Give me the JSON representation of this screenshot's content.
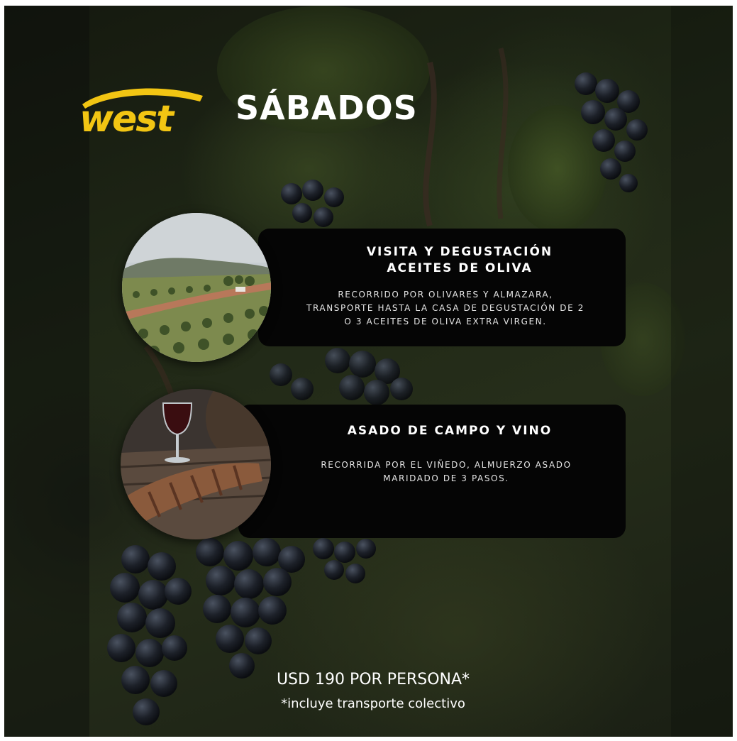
{
  "brand": {
    "logo_text": "west",
    "logo_color": "#f2c513"
  },
  "header": {
    "title": "SÁBADOS"
  },
  "experiences": [
    {
      "title_line1": "VISITA Y DEGUSTACIÓN",
      "title_line2": "ACEITES DE OLIVA",
      "desc_line1": "RECORRIDO POR OLIVARES Y ALMAZARA,",
      "desc_line2": "TRANSPORTE HASTA LA CASA DE DEGUSTACIÓN DE 2",
      "desc_line3": "O 3 ACEITES DE OLIVA EXTRA VIRGEN.",
      "image_icon": "olive-grove-photo"
    },
    {
      "title_line1": "ASADO DE CAMPO Y VINO",
      "desc_line1": "RECORRIDA POR EL VIÑEDO, ALMUERZO ASADO",
      "desc_line2": "MARIDADO DE 3 PASOS.",
      "image_icon": "asado-wine-photo"
    }
  ],
  "footer": {
    "price": "USD 190 POR PERSONA*",
    "note": "*incluye transporte colectivo"
  },
  "colors": {
    "card_bg": "#050505",
    "text": "#ffffff",
    "background": "#1f2716"
  }
}
